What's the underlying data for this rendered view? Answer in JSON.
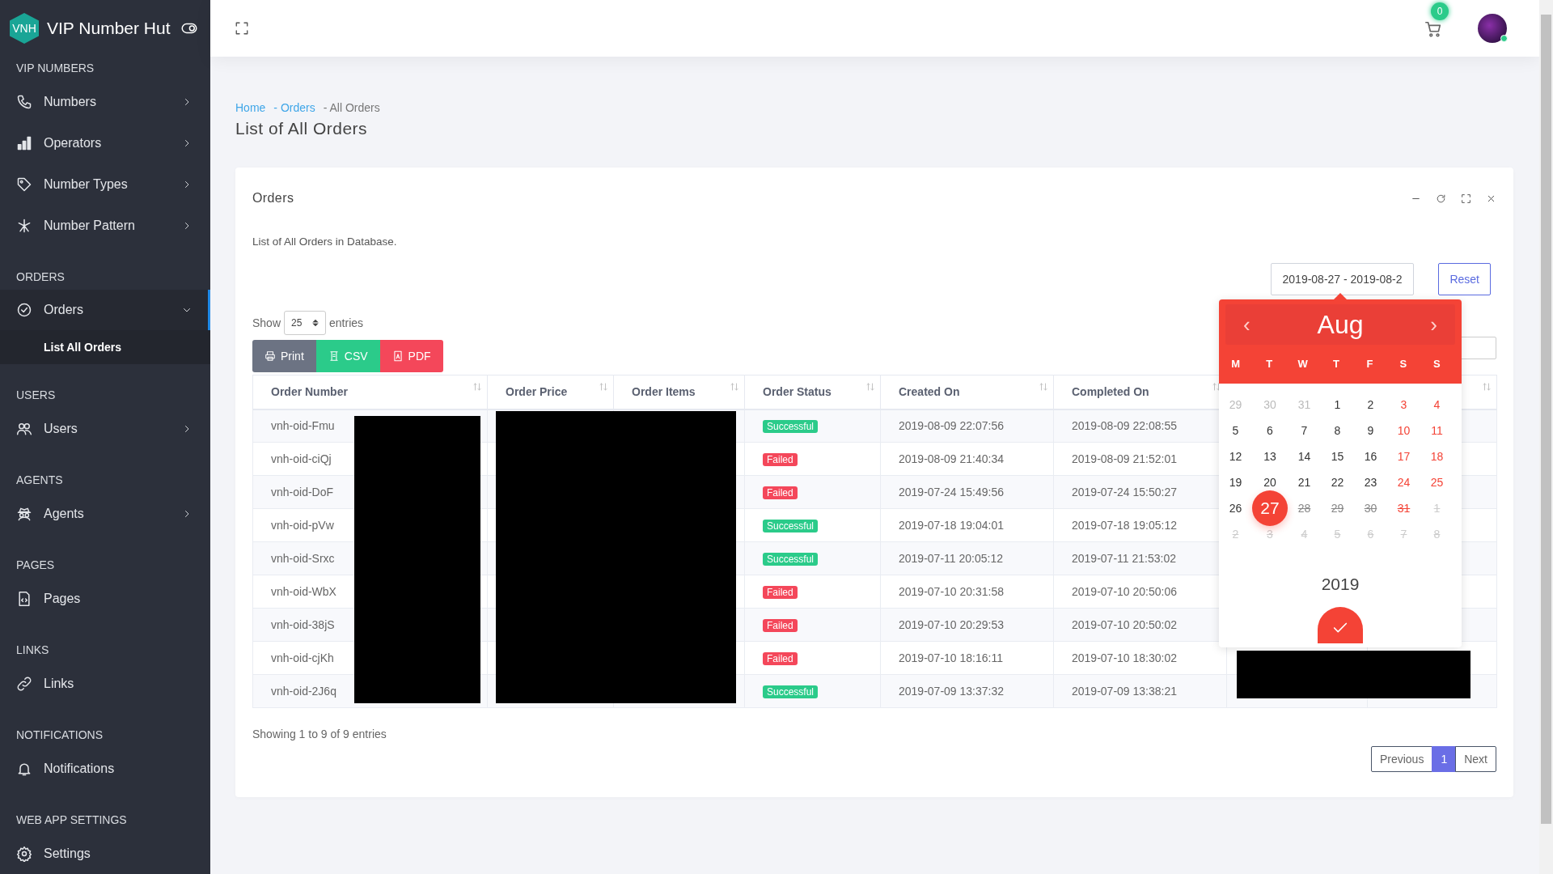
{
  "brand": {
    "logo": "VNH",
    "name": "VIP Number Hut"
  },
  "sidebar": {
    "sections": [
      {
        "heading": "VIP NUMBERS",
        "items": [
          {
            "label": "Numbers",
            "has_submenu": true,
            "expanded": false,
            "selected": false
          },
          {
            "label": "Operators",
            "has_submenu": true,
            "expanded": false,
            "selected": false
          },
          {
            "label": "Number Types",
            "has_submenu": true,
            "expanded": false,
            "selected": false
          },
          {
            "label": "Number Pattern",
            "has_submenu": true,
            "expanded": false,
            "selected": false
          }
        ]
      },
      {
        "heading": "ORDERS",
        "items": [
          {
            "label": "Orders",
            "has_submenu": true,
            "expanded": true,
            "selected": true,
            "children": [
              {
                "label": "List All Orders",
                "selected": true
              }
            ]
          }
        ]
      },
      {
        "heading": "USERS",
        "items": [
          {
            "label": "Users",
            "has_submenu": true,
            "expanded": false,
            "selected": false
          }
        ]
      },
      {
        "heading": "AGENTS",
        "items": [
          {
            "label": "Agents",
            "has_submenu": true,
            "expanded": false,
            "selected": false
          }
        ]
      },
      {
        "heading": "PAGES",
        "items": [
          {
            "label": "Pages",
            "has_submenu": false,
            "selected": false
          }
        ]
      },
      {
        "heading": "LINKS",
        "items": [
          {
            "label": "Links",
            "has_submenu": false,
            "selected": false
          }
        ]
      },
      {
        "heading": "NOTIFICATIONS",
        "items": [
          {
            "label": "Notifications",
            "has_submenu": false,
            "selected": false
          }
        ]
      },
      {
        "heading": "WEB APP SETTINGS",
        "items": [
          {
            "label": "Settings",
            "has_submenu": false,
            "selected": false
          }
        ]
      }
    ]
  },
  "header": {
    "cart_count": "0"
  },
  "breadcrumb": [
    {
      "label": "Home",
      "link": true
    },
    {
      "label": "- Orders",
      "link": true
    },
    {
      "label": "- All Orders",
      "link": false
    }
  ],
  "page_title": "List of All Orders",
  "card": {
    "title": "Orders",
    "description": "List of All Orders in Database.",
    "date_range": "2019-08-27 - 2019-08-2",
    "reset": "Reset",
    "length": {
      "before": "Show",
      "value": "25",
      "after": "entries"
    },
    "buttons": [
      {
        "label": "Print",
        "kind": "print"
      },
      {
        "label": "CSV",
        "kind": "csv"
      },
      {
        "label": "PDF",
        "kind": "pdf"
      }
    ],
    "table": {
      "columns": [
        "Order Number",
        "Order Price",
        "Order Items",
        "Order Status",
        "Created On",
        "Completed On"
      ],
      "rows": [
        {
          "order_number": "vnh-oid-Fmu",
          "status": "Successful",
          "kind": "success",
          "created": "2019-08-09 22:07:56",
          "completed": "2019-08-09 22:08:55"
        },
        {
          "order_number": "vnh-oid-ciQj",
          "status": "Failed",
          "kind": "failed",
          "created": "2019-08-09 21:40:34",
          "completed": "2019-08-09 21:52:01"
        },
        {
          "order_number": "vnh-oid-DoF",
          "status": "Failed",
          "kind": "failed",
          "created": "2019-07-24 15:49:56",
          "completed": "2019-07-24 15:50:27"
        },
        {
          "order_number": "vnh-oid-pVw",
          "status": "Successful",
          "kind": "success",
          "created": "2019-07-18 19:04:01",
          "completed": "2019-07-18 19:05:12"
        },
        {
          "order_number": "vnh-oid-Srxc",
          "status": "Successful",
          "kind": "success",
          "created": "2019-07-11 20:05:12",
          "completed": "2019-07-11 21:53:02"
        },
        {
          "order_number": "vnh-oid-WbX",
          "status": "Failed",
          "kind": "failed",
          "created": "2019-07-10 20:31:58",
          "completed": "2019-07-10 20:50:06"
        },
        {
          "order_number": "vnh-oid-38jS",
          "status": "Failed",
          "kind": "failed",
          "created": "2019-07-10 20:29:53",
          "completed": "2019-07-10 20:50:02"
        },
        {
          "order_number": "vnh-oid-cjKh",
          "status": "Failed",
          "kind": "failed",
          "created": "2019-07-10 18:16:11",
          "completed": "2019-07-10 18:30:02"
        },
        {
          "order_number": "vnh-oid-2J6q",
          "status": "Successful",
          "kind": "success",
          "created": "2019-07-09 13:37:32",
          "completed": "2019-07-09 13:38:21"
        }
      ],
      "info": "Showing 1 to 9 of 9 entries",
      "pagination": [
        {
          "label": "Previous",
          "selected": false
        },
        {
          "label": "1",
          "selected": true
        },
        {
          "label": "Next",
          "selected": false
        }
      ]
    }
  },
  "calendar": {
    "prev": "‹",
    "month": "Aug",
    "next": "›",
    "weekdays": [
      "M",
      "T",
      "W",
      "T",
      "F",
      "S",
      "S"
    ],
    "year": "2019",
    "days": [
      {
        "label": "29",
        "kind": "other",
        "selected": false
      },
      {
        "label": "30",
        "kind": "other",
        "selected": false
      },
      {
        "label": "31",
        "kind": "other",
        "selected": false
      },
      {
        "label": "1",
        "kind": "day",
        "selected": false
      },
      {
        "label": "2",
        "kind": "day",
        "selected": false
      },
      {
        "label": "3",
        "kind": "weekend",
        "selected": false
      },
      {
        "label": "4",
        "kind": "weekend",
        "selected": false
      },
      {
        "label": "5",
        "kind": "day",
        "selected": false
      },
      {
        "label": "6",
        "kind": "day",
        "selected": false
      },
      {
        "label": "7",
        "kind": "day",
        "selected": false
      },
      {
        "label": "8",
        "kind": "day",
        "selected": false
      },
      {
        "label": "9",
        "kind": "day",
        "selected": false
      },
      {
        "label": "10",
        "kind": "weekend",
        "selected": false
      },
      {
        "label": "11",
        "kind": "weekend",
        "selected": false
      },
      {
        "label": "12",
        "kind": "day",
        "selected": false
      },
      {
        "label": "13",
        "kind": "day",
        "selected": false
      },
      {
        "label": "14",
        "kind": "day",
        "selected": false
      },
      {
        "label": "15",
        "kind": "day",
        "selected": false
      },
      {
        "label": "16",
        "kind": "day",
        "selected": false
      },
      {
        "label": "17",
        "kind": "weekend",
        "selected": false
      },
      {
        "label": "18",
        "kind": "weekend",
        "selected": false
      },
      {
        "label": "19",
        "kind": "day",
        "selected": false
      },
      {
        "label": "20",
        "kind": "day",
        "selected": false
      },
      {
        "label": "21",
        "kind": "day",
        "selected": false
      },
      {
        "label": "22",
        "kind": "day",
        "selected": false
      },
      {
        "label": "23",
        "kind": "day",
        "selected": false
      },
      {
        "label": "24",
        "kind": "weekend",
        "selected": false
      },
      {
        "label": "25",
        "kind": "weekend",
        "selected": false
      },
      {
        "label": "26",
        "kind": "day",
        "selected": false
      },
      {
        "label": "27",
        "kind": "day",
        "selected": true
      },
      {
        "label": "28",
        "kind": "struck",
        "selected": false
      },
      {
        "label": "29",
        "kind": "struck",
        "selected": false
      },
      {
        "label": "30",
        "kind": "struck",
        "selected": false
      },
      {
        "label": "31",
        "kind": "struck-weekend",
        "selected": false
      },
      {
        "label": "1",
        "kind": "struck-other",
        "selected": false
      },
      {
        "label": "2",
        "kind": "struck-other",
        "selected": false
      },
      {
        "label": "3",
        "kind": "struck-other",
        "selected": false
      },
      {
        "label": "4",
        "kind": "struck-other",
        "selected": false
      },
      {
        "label": "5",
        "kind": "struck-other",
        "selected": false
      },
      {
        "label": "6",
        "kind": "struck-other",
        "selected": false
      },
      {
        "label": "7",
        "kind": "struck-other",
        "selected": false
      },
      {
        "label": "8",
        "kind": "struck-other",
        "selected": false
      }
    ]
  }
}
